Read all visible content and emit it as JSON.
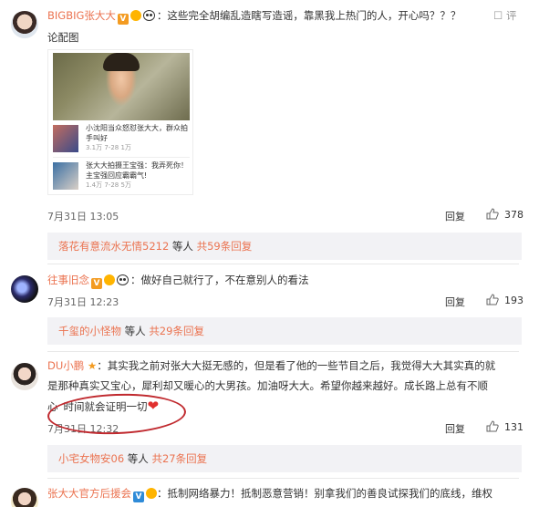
{
  "comments": [
    {
      "user": "BIGBIG张大大",
      "text_line1": "：这些完全胡编乱造瞎写造谣，靠黑我上热门的人，开心吗？？？",
      "text_line2": "论配图",
      "time": "7月31日 13:05",
      "reply_label": "回复",
      "likes": "378",
      "right_label": "评",
      "sub_summary": {
        "user": "落花有意流水无情5212",
        "mid": " 等人 ",
        "count": "共59条回复"
      }
    },
    {
      "user": "往事旧念",
      "text_line1": "：做好自己就行了，不在意别人的看法",
      "time": "7月31日 12:23",
      "reply_label": "回复",
      "likes": "193",
      "sub_summary": {
        "user": "千玺的小怪物",
        "mid": " 等人 ",
        "count": "共29条回复"
      }
    },
    {
      "user": "DU小鹏",
      "text_line1": "：其实我之前对张大大挺无感的，但是看了他的一些节目之后，我觉得大大其实真的就",
      "text_line2": "是那种真实又宝心，犀利却又暖心的大男孩。加油呀大大。希望你越来越好。成长路上总有不顺",
      "text_line3a": "心",
      "text_line3b": "时间就会证明一切",
      "heart": "❤",
      "time": "7月31日 12:32",
      "reply_label": "回复",
      "likes": "131",
      "sub_summary": {
        "user": "小宅女物安06",
        "mid": " 等人 ",
        "count": "共27条回复"
      }
    },
    {
      "user": "张大大官方后援会",
      "text_line1": "：抵制网络暴力！抵制恶意营销！别拿我们的善良试探我们的底线，维权"
    }
  ],
  "card": {
    "rows": [
      {
        "title": "小沈阳当众怒怼张大大，群众拍手叫好",
        "meta": "3.1万    7-28  1万"
      },
      {
        "title": "张大大拍摄王宝强：我弄死你！ 主宝强回应霸霸气!",
        "meta": "1.4万    7-28  5万"
      }
    ]
  },
  "icons": {
    "v_badge": "V"
  }
}
